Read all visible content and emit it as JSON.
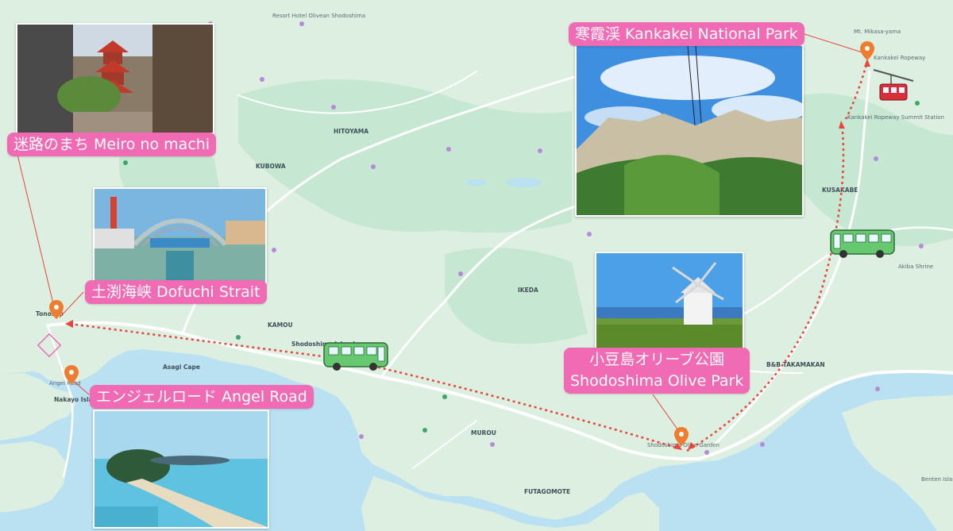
{
  "spots": {
    "meiro": {
      "label": "迷路のまち Meiro no machi"
    },
    "dofuchi": {
      "label": "土渕海峡 Dofuchi Strait"
    },
    "angel": {
      "label": "エンジェルロード Angel Road"
    },
    "kankakei": {
      "label": "寒霞渓 Kankakei National Park"
    },
    "olive": {
      "line1": "小豆島オリーブ公園",
      "line2": "Shodoshima Olive Park"
    }
  },
  "map_labels": {
    "tonosho": "Tonosho",
    "shodoshima_island": "Shodoshima Island",
    "asagi_cape": "Asagi Cape",
    "angel_road": "Angel Road",
    "nakayo_island": "Nakayo Island",
    "olive_garden": "Shodoshima Olive Garden",
    "kankakei_ropeway": "Kankakei Ropeway",
    "kankakei_station": "Kankakei Ropeway Summit Station",
    "mt_mikasa": "Mt. Mikasa-yama",
    "hitoyama": "HITOYAMA",
    "kubowa": "KUBOWA",
    "ikeda": "IKEDA",
    "kamou": "KAMOU",
    "murou": "MUROU",
    "futagomote": "FUTAGOMOTE",
    "b_b_takamakan": "B&B TAKAMAKAN",
    "akiba_shrine": "Akiba Shrine",
    "benten": "Benten Island",
    "kusakabe": "KUSAKABE",
    "resort_hotel": "Resort Hotel Olivean Shodoshima",
    "olive_park": "Shodoshima Olive Park"
  },
  "colors": {
    "pill": "#f06bb4",
    "land": "#dcefe1",
    "green_land": "#c6e8d2",
    "sea": "#b9e1f2",
    "route": "#e8453c",
    "road": "#ffffff"
  },
  "icons": [
    "map-pin-icon",
    "bus-icon",
    "ropeway-gondola-icon"
  ]
}
